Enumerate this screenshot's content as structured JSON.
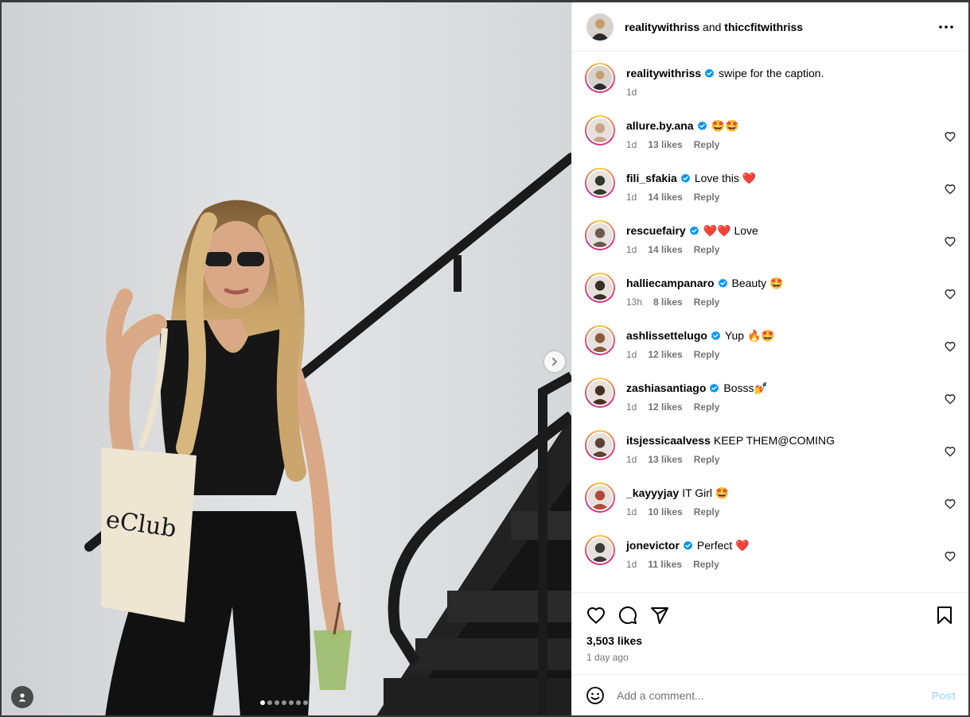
{
  "post": {
    "author": "realitywithriss",
    "collab_joiner": "and",
    "collaborator": "thiccfitwithriss",
    "caption": "swipe for the caption.",
    "caption_time": "1d",
    "likes": "3,503 likes",
    "posted": "1 day ago",
    "carousel_count": 7,
    "carousel_active": 0
  },
  "comments": [
    {
      "user": "allure.by.ana",
      "verified": true,
      "text": "🤩🤩",
      "time": "1d",
      "likes": "13 likes",
      "reply": "Reply",
      "color": "#c9a48a"
    },
    {
      "user": "fili_sfakia",
      "verified": true,
      "text": "Love this ❤️",
      "time": "1d",
      "likes": "14 likes",
      "reply": "Reply",
      "color": "#2e3a2a"
    },
    {
      "user": "rescuefairy",
      "verified": true,
      "text": "❤️❤️ Love",
      "time": "1d",
      "likes": "14 likes",
      "reply": "Reply",
      "color": "#6b5a4e"
    },
    {
      "user": "halliecampanaro",
      "verified": true,
      "text": "Beauty 🤩",
      "time": "13h",
      "likes": "8 likes",
      "reply": "Reply",
      "color": "#3b2f2a"
    },
    {
      "user": "ashlissettelugo",
      "verified": true,
      "text": "Yup 🔥🤩",
      "time": "1d",
      "likes": "12 likes",
      "reply": "Reply",
      "color": "#8a5a3a"
    },
    {
      "user": "zashiasantiago",
      "verified": true,
      "text": "Bosss💅",
      "time": "1d",
      "likes": "12 likes",
      "reply": "Reply",
      "color": "#4a2e22"
    },
    {
      "user": "itsjessicaalvess",
      "verified": false,
      "text": "KEEP THEM@COMING",
      "time": "1d",
      "likes": "13 likes",
      "reply": "Reply",
      "color": "#5a4236"
    },
    {
      "user": "_kayyyjay",
      "verified": false,
      "text": "IT Girl 🤩",
      "time": "1d",
      "likes": "10 likes",
      "reply": "Reply",
      "color": "#b04a3a"
    },
    {
      "user": "jonevictor",
      "verified": true,
      "text": "Perfect ❤️",
      "time": "1d",
      "likes": "11 likes",
      "reply": "Reply",
      "color": "#3a3a3a"
    }
  ],
  "add_comment": {
    "placeholder": "Add a comment...",
    "post_label": "Post"
  },
  "icons": {
    "more": "more-horizontal-icon",
    "like": "heart-icon",
    "comment": "comment-bubble-icon",
    "share": "paper-plane-icon",
    "save": "bookmark-icon",
    "emoji": "smiley-icon",
    "next": "chevron-right-icon",
    "tags": "user-tag-icon"
  },
  "colors": {
    "verified": "#0095f6",
    "post_button_disabled": "#b2dffc",
    "secondary_text": "#737373"
  }
}
